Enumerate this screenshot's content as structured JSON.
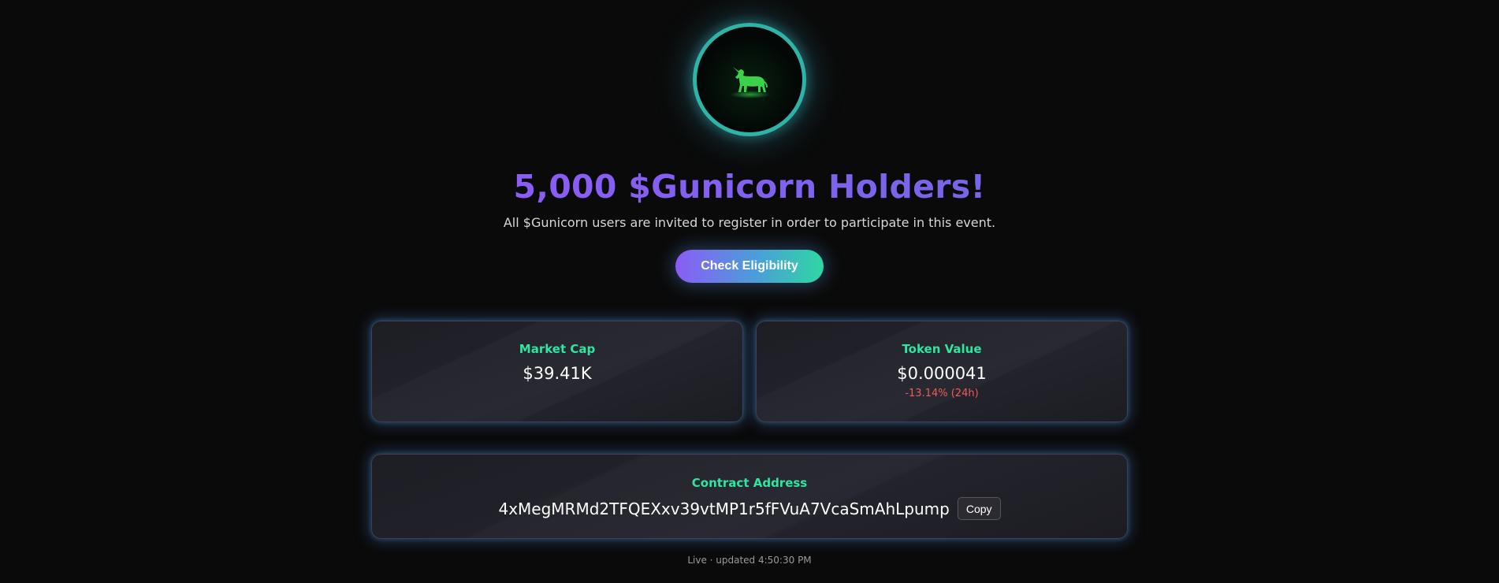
{
  "hero": {
    "logo_icon": "unicorn-icon",
    "headline": "5,000 $Gunicorn Holders!",
    "subtitle": "All $Gunicorn users are invited to register in order to participate in this event.",
    "cta_label": "Check Eligibility"
  },
  "stats": {
    "market_cap": {
      "label": "Market Cap",
      "value": "$39.41K"
    },
    "token_value": {
      "label": "Token Value",
      "value": "$0.000041",
      "change": "-13.14% (24h)"
    }
  },
  "contract": {
    "label": "Contract Address",
    "address": "4xMegMRMd2TFQEXxv39vtMP1r5fFVuA7VcaSmAhLpump",
    "copy_label": "Copy"
  },
  "footer": {
    "status": "Live · updated 4:50:30 PM"
  },
  "colors": {
    "background": "#0a0a0a",
    "accent_purple": "#8b5cf6",
    "accent_green": "#2ee6a0",
    "accent_teal": "#2fb3a7",
    "negative": "#f05a5a"
  }
}
